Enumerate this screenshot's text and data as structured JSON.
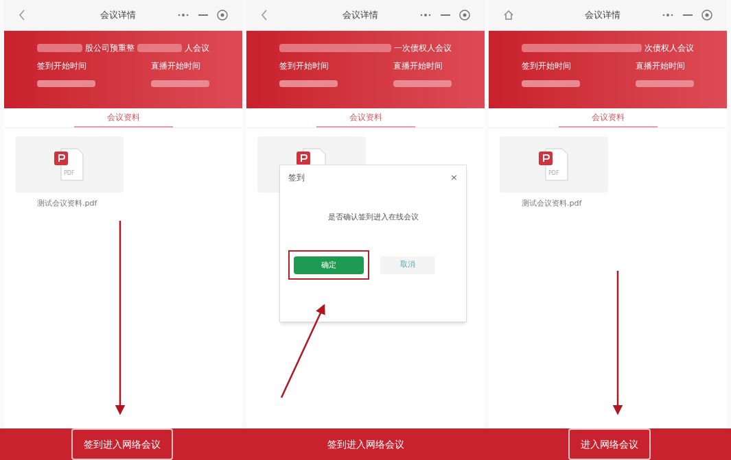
{
  "panels": [
    {
      "nav": {
        "kind": "back"
      },
      "nav_title": "会议详情",
      "title_parts": [
        {
          "kind": "redacted"
        },
        {
          "kind": "text",
          "text": "股公司预重整"
        },
        {
          "kind": "redacted"
        },
        {
          "kind": "text",
          "text": "人会议"
        }
      ],
      "labels": [
        "签到开始时间",
        "直播开始时间"
      ],
      "tab": "会议资料",
      "file": {
        "name": "测试会议资料.pdf",
        "badge": "PDF"
      },
      "arrow": {
        "kind": "down"
      }
    },
    {
      "nav": {
        "kind": "back"
      },
      "nav_title": "会议详情",
      "title_parts": [
        {
          "kind": "redacted"
        },
        {
          "kind": "text",
          "text": "一次债权人会议"
        }
      ],
      "labels": [
        "签到开始时间",
        "直播开始时间"
      ],
      "tab": "会议资料",
      "dialog": {
        "title": "签到",
        "close": "×",
        "message": "是否确认签到进入在线会议",
        "confirm": "确定",
        "cancel": "取消",
        "confirm_highlighted": true
      },
      "arrow": {
        "kind": "up"
      }
    },
    {
      "nav": {
        "kind": "home"
      },
      "nav_title": "会议详情",
      "title_parts": [
        {
          "kind": "redacted"
        },
        {
          "kind": "text",
          "text": "次债权人会议"
        }
      ],
      "labels": [
        "签到开始时间",
        "直播开始时间"
      ],
      "tab": "会议资料",
      "file": {
        "name": "测试会议资料.pdf",
        "badge": "PDF"
      },
      "arrow": {
        "kind": "down"
      }
    }
  ],
  "bottom_buttons": [
    {
      "label": "签到进入网络会议",
      "highlighted": true
    },
    {
      "label": "签到进入网络会议",
      "highlighted": false
    },
    {
      "label": "进入网络会议",
      "highlighted": true
    }
  ]
}
